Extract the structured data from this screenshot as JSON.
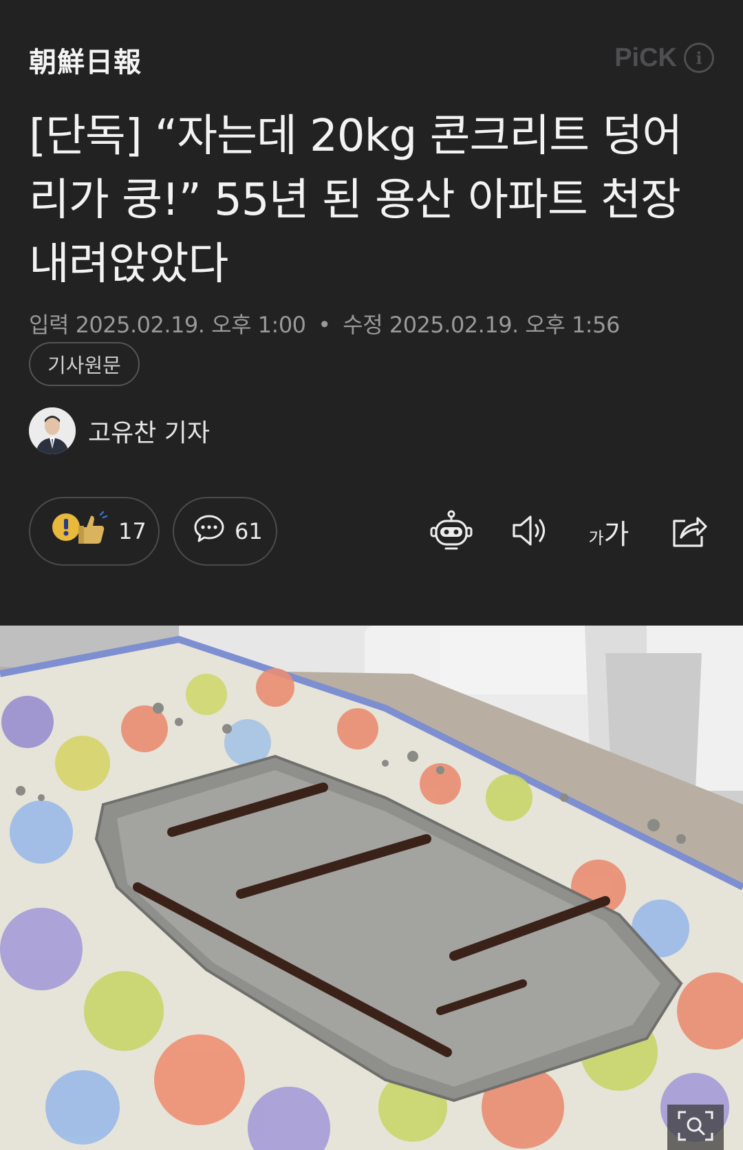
{
  "header": {
    "logo_text": "朝鮮日報",
    "pick_label": "PiCK",
    "info_glyph": "i"
  },
  "article": {
    "headline": "[단독] “자는데 20kg 콘크리트 덩어리가 쿵!” 55년 된 용산 아파트 천장 내려앉았다",
    "published_label": "입력",
    "published_at": "2025.02.19. 오후 1:00",
    "separator": "•",
    "modified_label": "수정",
    "modified_at": "2025.02.19. 오후 1:56",
    "source_button": "기사원문",
    "author": "고유찬 기자"
  },
  "reactions": {
    "like_count": "17",
    "comment_count": "61"
  },
  "tools": {
    "font_small": "가",
    "font_big": "가"
  },
  "icons": {
    "pick_info": "info-icon",
    "reaction": "thumbs-up-icon",
    "comment": "speech-bubble-icon",
    "summary": "robot-icon",
    "tts": "speaker-icon",
    "share": "share-icon",
    "zoom": "zoom-icon"
  },
  "colors": {
    "background": "#222223",
    "muted_text": "#9a9a9c",
    "pill_border": "#4c4c4f"
  }
}
